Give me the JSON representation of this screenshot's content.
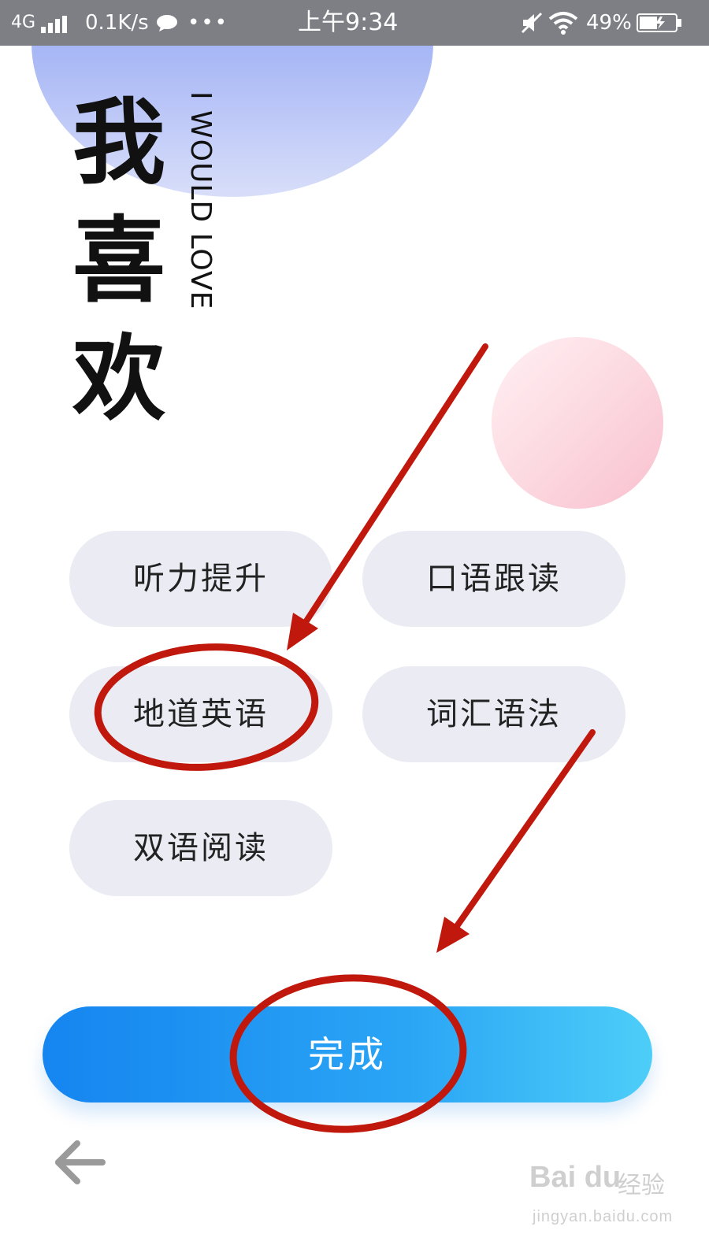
{
  "status_bar": {
    "network": "4G",
    "speed": "0.1K/s",
    "dots": "•••",
    "time": "上午9:34",
    "battery": "49%"
  },
  "header": {
    "title_chars": [
      "我",
      "喜",
      "欢"
    ],
    "subtitle": "I WOULD LOVE"
  },
  "options": [
    {
      "label": "听力提升"
    },
    {
      "label": "口语跟读"
    },
    {
      "label": "地道英语"
    },
    {
      "label": "词汇语法"
    },
    {
      "label": "双语阅读"
    }
  ],
  "done_label": "完成",
  "watermark": {
    "logo": "Bai du",
    "cn": "经验",
    "url": "jingyan.baidu.com"
  },
  "colors": {
    "chip_bg": "#ebecf3",
    "button_start": "#1585f0",
    "button_end": "#4dcef8",
    "annotation": "#c0180c"
  },
  "icons": [
    "signal-icon",
    "chat-icon",
    "mute-icon",
    "wifi-icon",
    "battery-icon",
    "back-arrow-icon"
  ]
}
